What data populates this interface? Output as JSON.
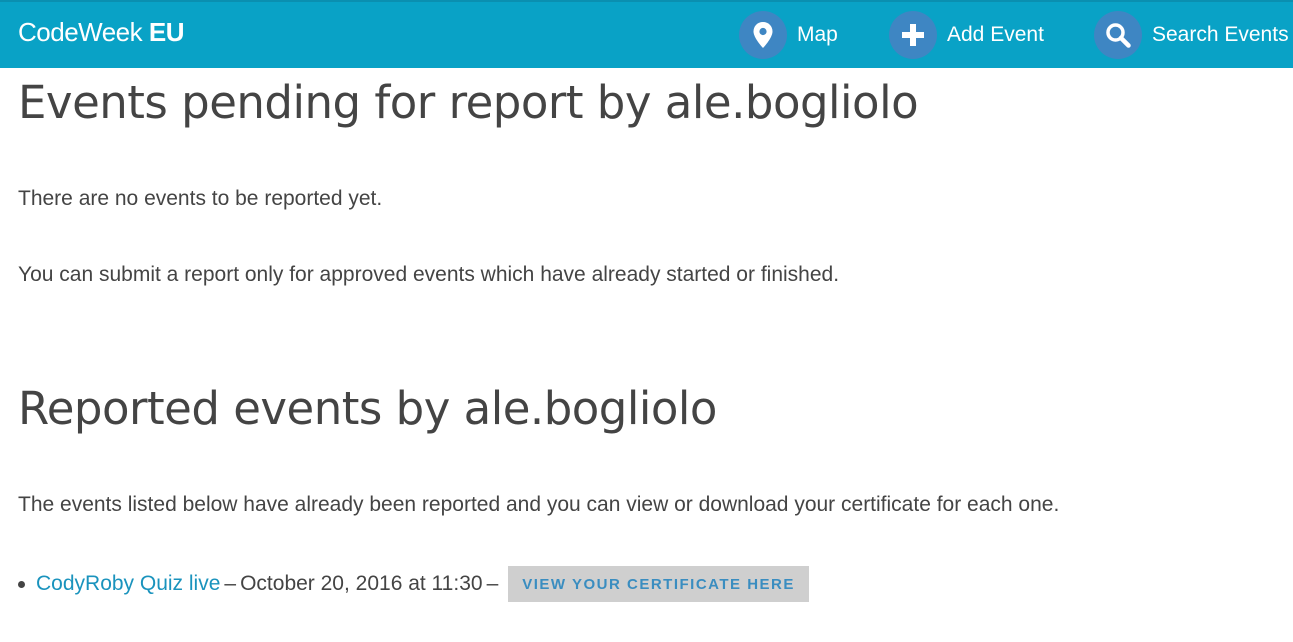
{
  "header": {
    "brand_light": "CodeWeek",
    "brand_bold": "EU",
    "nav": [
      {
        "label": "Map",
        "icon": "map-marker-icon"
      },
      {
        "label": "Add Event",
        "icon": "plus-icon"
      },
      {
        "label": "Search Events",
        "icon": "search-icon"
      }
    ],
    "colors": {
      "bar": "#09a2c6",
      "nav_circle": "#3e86c3"
    }
  },
  "pending": {
    "title": "Events pending for report by ale.bogliolo",
    "no_events_text": "There are no events to be reported yet.",
    "info_text": "You can submit a report only for approved events which have already started or finished."
  },
  "reported": {
    "title": "Reported events by ale.bogliolo",
    "intro_text": "The events listed below have already been reported and you can view or download your certificate for each one.",
    "events": [
      {
        "name": "CodyRoby Quiz live",
        "date": "October 20, 2016 at 11:30",
        "certificate_label": "VIEW YOUR CERTIFICATE HERE"
      }
    ],
    "separator": "–",
    "colors": {
      "link": "#1a93bd",
      "cert_button_bg": "#cfcfcf",
      "cert_button_text": "#3a8dc0"
    }
  }
}
